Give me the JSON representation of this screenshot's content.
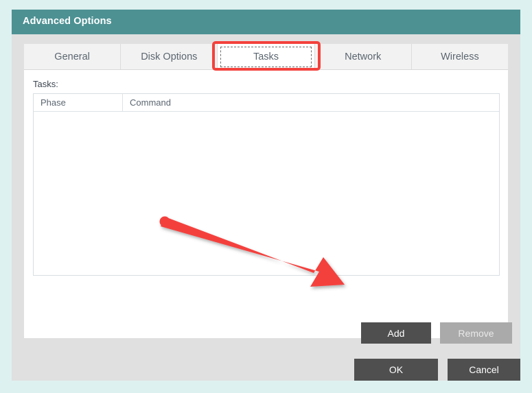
{
  "window": {
    "title": "Advanced Options",
    "titlebar_color": "#4d9193",
    "background_color": "#ddf1f0"
  },
  "tabs": [
    {
      "label": "General",
      "active": false
    },
    {
      "label": "Disk Options",
      "active": false
    },
    {
      "label": "Tasks",
      "active": true
    },
    {
      "label": "Network",
      "active": false
    },
    {
      "label": "Wireless",
      "active": false
    }
  ],
  "tasks_panel": {
    "section_label": "Tasks:",
    "table": {
      "columns": [
        "Phase",
        "Command"
      ],
      "rows": []
    },
    "buttons": {
      "add": {
        "label": "Add",
        "enabled": true
      },
      "remove": {
        "label": "Remove",
        "enabled": false
      }
    }
  },
  "footer": {
    "ok_label": "OK",
    "cancel_label": "Cancel"
  },
  "annotations": {
    "highlight_color": "#f4413c",
    "highlight_target": "Tasks",
    "arrow_target": "Add"
  }
}
